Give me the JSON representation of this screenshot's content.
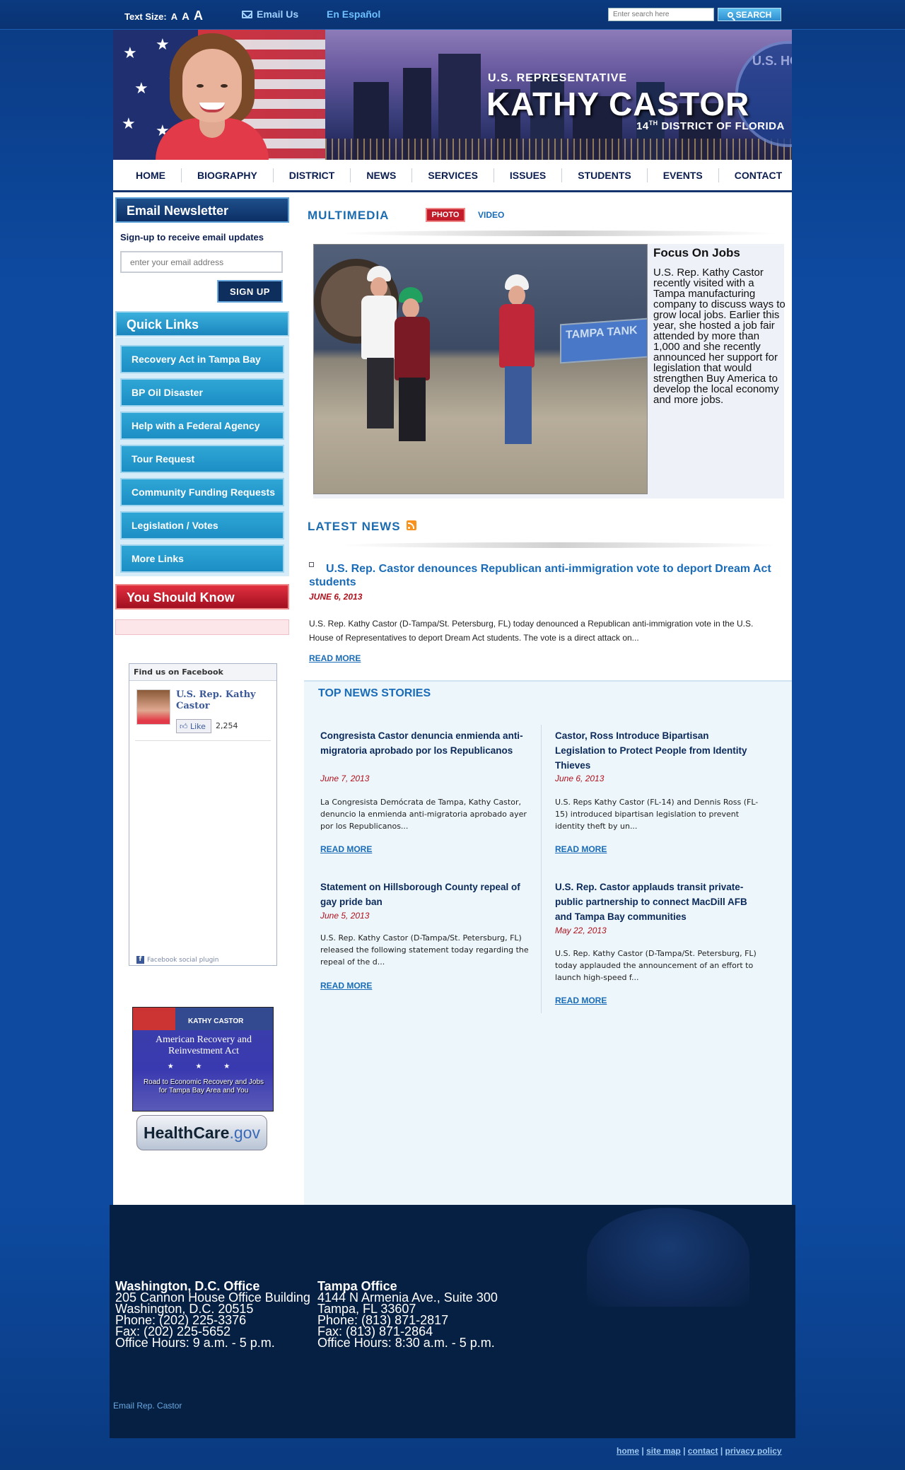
{
  "topbar": {
    "text_size_label": "Text Size:",
    "size_a1": "A",
    "size_a2": "A",
    "size_a3": "A",
    "email_us": "Email Us",
    "espanol": "En Español",
    "search_placeholder": "Enter search here",
    "search_button": "SEARCH"
  },
  "banner": {
    "small": "U.S. REPRESENTATIVE",
    "name": "KATHY CASTOR",
    "district_num": "14",
    "district_sup": "TH",
    "district_rest": "DISTRICT OF FLORIDA",
    "seal_text": "U.S. HO"
  },
  "nav": [
    "HOME",
    "BIOGRAPHY",
    "DISTRICT",
    "NEWS",
    "SERVICES",
    "ISSUES",
    "STUDENTS",
    "EVENTS",
    "CONTACT"
  ],
  "sidebar": {
    "newsletter_title": "Email Newsletter",
    "newsletter_text": "Sign-up to receive email updates",
    "email_placeholder": "enter your email address",
    "signup": "SIGN UP",
    "quick_links_title": "Quick Links",
    "quick_links": [
      "Recovery Act in Tampa Bay",
      "BP Oil Disaster",
      "Help with a Federal Agency",
      "Tour Request",
      "Community Funding Requests",
      "Legislation / Votes",
      "More Links"
    ],
    "should_know_title": "You Should Know",
    "facebook": {
      "title": "Find us on Facebook",
      "name": "U.S. Rep. Kathy Castor",
      "like": "Like",
      "count": "2,254",
      "plugin": "Facebook social plugin"
    },
    "recovery": {
      "name": "KATHY CASTOR",
      "title": "American Recovery and Reinvestment Act",
      "stars": "★ ★ ★",
      "sub": "Road to Economic Recovery and Jobs for Tampa Bay Area and You"
    },
    "healthcare": {
      "a": "HealthCare",
      "b": ".gov"
    }
  },
  "multimedia": {
    "title": "MULTIMEDIA",
    "photo_tab": "PHOTO",
    "video_tab": "VIDEO",
    "sign_text": "TAMPA TANK",
    "feature_title": "Focus On Jobs",
    "feature_body": "U.S. Rep. Kathy Castor recently visited with a Tampa manufacturing company to discuss ways to grow local jobs. Earlier this year, she hosted a job fair attended by more than 1,000 and she recently announced her support for legislation that would strengthen Buy America to develop the local economy and more jobs."
  },
  "latest_news": {
    "title": "LATEST NEWS",
    "headline": "U.S. Rep. Castor denounces Republican anti-immigration vote to deport Dream Act students",
    "date": "JUNE 6, 2013",
    "body": "U.S. Rep. Kathy Castor (D-Tampa/St. Petersburg, FL) today denounced a Republican anti-immigration vote in the U.S. House of Representatives to deport Dream Act students. The vote is a direct attack on...",
    "read_more": "READ MORE"
  },
  "top_news": {
    "title": "TOP NEWS STORIES",
    "read_more": "READ MORE",
    "stories": [
      {
        "title": "Congresista Castor denuncia enmienda anti-migratoria aprobado por los Republicanos",
        "date": "June 7, 2013",
        "body": "La Congresista Demócrata de Tampa, Kathy Castor, denuncio la enmienda anti-migratoria aprobado ayer por los Republicanos..."
      },
      {
        "title": "Castor, Ross Introduce Bipartisan Legislation to Protect People from Identity Thieves",
        "date": "June 6, 2013",
        "body": "U.S. Reps Kathy Castor (FL-14) and Dennis Ross (FL-15) introduced bipartisan legislation to prevent identity theft by un..."
      },
      {
        "title": "Statement on Hillsborough County repeal of gay pride ban",
        "date": "June 5, 2013",
        "body": "U.S. Rep. Kathy Castor (D-Tampa/St. Petersburg, FL) released the following statement today regarding the repeal of the d..."
      },
      {
        "title": "U.S. Rep. Castor applauds transit private-public partnership to connect MacDill AFB and Tampa Bay communities",
        "date": "May 22, 2013",
        "body": "U.S. Rep. Kathy Castor (D-Tampa/St. Petersburg, FL) today applauded the announcement of an effort to launch high-speed f..."
      }
    ]
  },
  "footer": {
    "dc": {
      "heading": "Washington, D.C. Office",
      "l1": "205 Cannon House Office Building",
      "l2": "Washington, D.C. 20515",
      "l3": "Phone: (202) 225-3376",
      "l4": "Fax: (202) 225-5652",
      "l5": "Office Hours: 9 a.m. - 5 p.m."
    },
    "tampa": {
      "heading": "Tampa Office",
      "l1": "4144 N Armenia Ave., Suite 300",
      "l2": "Tampa, FL 33607",
      "l3": "Phone: (813) 871-2817",
      "l4": "Fax: (813) 871-2864",
      "l5": "Office Hours: 8:30 a.m. - 5 p.m."
    },
    "email_rep": "Email Rep. Castor",
    "links": [
      "home",
      "site map",
      "contact",
      "privacy policy"
    ],
    "sep": "|"
  }
}
